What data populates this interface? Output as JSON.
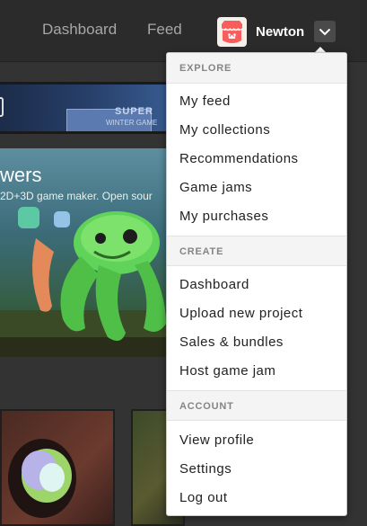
{
  "nav": {
    "dashboard": "Dashboard",
    "feed": "Feed"
  },
  "user": {
    "name": "Newton",
    "avatar_icon": "itchio-logo-icon",
    "menu_icon": "chevron-down-icon"
  },
  "background": {
    "banner_text": "SUPER",
    "banner_subtext": "WINTER GAME",
    "feature_title": "wers",
    "feature_subtitle": "2D+3D game maker. Open sour"
  },
  "menu": {
    "sections": [
      {
        "header": "EXPLORE",
        "items": [
          "My feed",
          "My collections",
          "Recommendations",
          "Game jams",
          "My purchases"
        ]
      },
      {
        "header": "CREATE",
        "items": [
          "Dashboard",
          "Upload new project",
          "Sales & bundles",
          "Host game jam"
        ]
      },
      {
        "header": "ACCOUNT",
        "items": [
          "View profile",
          "Settings",
          "Log out"
        ]
      }
    ]
  },
  "colors": {
    "brand": "#fa5c5c",
    "topbar": "#2b2b2b",
    "menu_background": "#ffffff",
    "section_header_text": "#858585"
  }
}
